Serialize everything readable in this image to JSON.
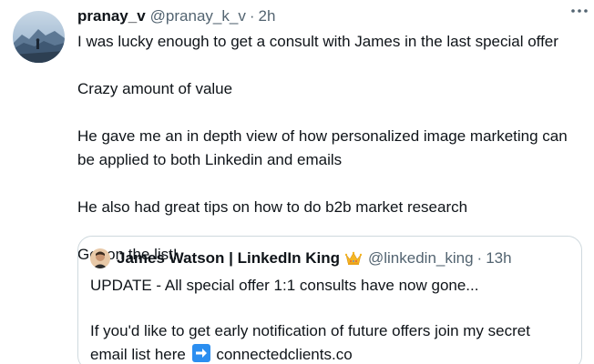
{
  "tweet": {
    "author_name": "pranay_v",
    "author_handle": "@pranay_k_v",
    "separator": "·",
    "time": "2h",
    "more_icon": "more-horizontal-icon",
    "paragraphs": [
      "I was lucky enough to get a consult with James in the last special offer",
      "Crazy amount of value",
      "He gave me an in depth view of how personalized image marketing can be applied to both Linkedin and emails",
      "He also had great tips on how to do b2b market research",
      "Get on the list!"
    ]
  },
  "quoted_tweet": {
    "author_name": "James Watson | LinkedIn King",
    "author_emoji": "crown-emoji",
    "author_handle": "@linkedin_king",
    "separator": "·",
    "time": "13h",
    "line1": "UPDATE - All special offer 1:1 consults have now gone...",
    "line2_part1": "If you'd like to get early notification of future offers join my secret email list here",
    "line2_emoji": "right-arrow-emoji",
    "line2_link": "connectedclients.co"
  },
  "colors": {
    "text": "#0f1419",
    "secondary": "#536471",
    "border": "#cfd9de"
  }
}
